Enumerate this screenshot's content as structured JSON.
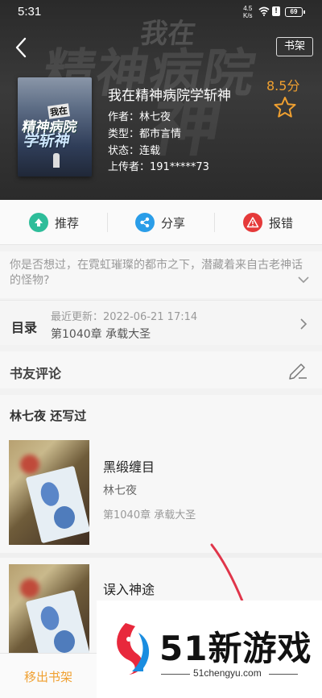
{
  "status_bar": {
    "time": "5:31",
    "net_speed_value": "4.5",
    "net_speed_unit": "K/s",
    "battery": "69",
    "icons": [
      "wifi-icon",
      "alert-icon",
      "battery-icon"
    ]
  },
  "header": {
    "back_icon": "chevron-left-icon",
    "shelf_button": "书架",
    "background_small_text": "我在",
    "background_big_text": "精神病院",
    "background_big_text2": "神"
  },
  "book": {
    "cover_small": "我在",
    "cover_mid": "精神病院",
    "cover_big": "学斩神",
    "title": "我在精神病院学斩神",
    "author": "作者：林七夜",
    "genre": "类型：都市言情",
    "status": "状态：连载",
    "uploader": "上传者：191*****73",
    "score": "8.5分",
    "star_icon": "star-outline-icon"
  },
  "actions": [
    {
      "label": "推荐",
      "icon": "thumb-up-icon",
      "color": "#2ebd9a"
    },
    {
      "label": "分享",
      "icon": "share-icon",
      "color": "#2a9de8"
    },
    {
      "label": "报错",
      "icon": "warning-icon",
      "color": "#e53a3a"
    }
  ],
  "synopsis": {
    "text": "你是否想过，在霓虹璀璨的都市之下，潜藏着来自古老神话的怪物?"
  },
  "toc": {
    "label": "目录",
    "latest_update": "最近更新：2022-06-21 17:14",
    "latest_chapter": "第1040章 承载大圣"
  },
  "reviews": {
    "label": "书友评论",
    "edit_icon": "pencil-edit-icon"
  },
  "also_wrote": {
    "heading": "林七夜  还写过",
    "books": [
      {
        "title": "黑缎缠目",
        "author": "林七夜",
        "chapter": "第1040章 承载大圣"
      },
      {
        "title": "误入神途"
      }
    ]
  },
  "bottom": {
    "remove_button": "移出书架"
  },
  "watermark": {
    "brand": "51新游戏",
    "url": "51chengyu.com"
  },
  "colors": {
    "accent": "#f0a030",
    "header_bg": "#2e2e2e"
  }
}
